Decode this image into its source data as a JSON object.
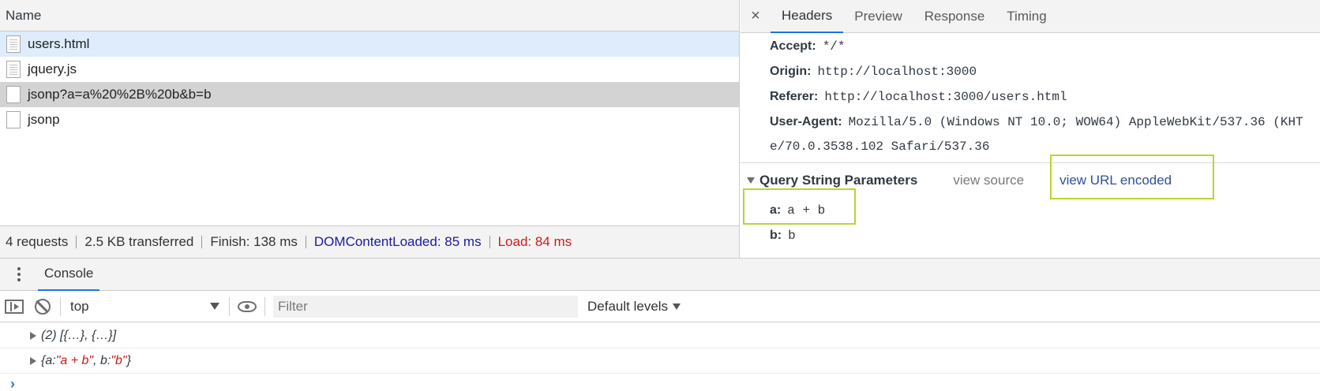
{
  "network": {
    "column_name": "Name",
    "requests": [
      {
        "name": "users.html",
        "icon": "document-icon"
      },
      {
        "name": "jquery.js",
        "icon": "document-icon"
      },
      {
        "name": "jsonp?a=a%20%2B%20b&b=b",
        "icon": "blank-file-icon"
      },
      {
        "name": "jsonp",
        "icon": "blank-file-icon"
      }
    ],
    "status": {
      "requests": "4 requests",
      "transferred": "2.5 KB transferred",
      "finish": "Finish: 138 ms",
      "dom_content_loaded": "DOMContentLoaded: 85 ms",
      "load": "Load: 84 ms"
    }
  },
  "details": {
    "close_symbol": "×",
    "tabs": [
      "Headers",
      "Preview",
      "Response",
      "Timing"
    ],
    "active_tab": "Headers",
    "headers": [
      {
        "key": "Accept:",
        "value": "*/*"
      },
      {
        "key": "Origin:",
        "value": "http://localhost:3000"
      },
      {
        "key": "Referer:",
        "value": "http://localhost:3000/users.html"
      },
      {
        "key": "User-Agent:",
        "value": "Mozilla/5.0 (Windows NT 10.0; WOW64) AppleWebKit/537.36 (KHT"
      }
    ],
    "user_agent_continuation": "e/70.0.3538.102 Safari/537.36",
    "query_string": {
      "title": "Query String Parameters",
      "view_source": "view source",
      "view_url_encoded": "view URL encoded",
      "params": [
        {
          "key": "a:",
          "value": "a + b"
        },
        {
          "key": "b:",
          "value": "b"
        }
      ]
    }
  },
  "drawer": {
    "tab": "Console",
    "toolbar": {
      "context": "top",
      "filter_placeholder": "Filter",
      "levels": "Default levels"
    },
    "output": {
      "line1": "(2) [{…}, {…}]",
      "line2_prefix": "{a: ",
      "line2_a": "\"a + b\"",
      "line2_mid": ", b: ",
      "line2_b": "\"b\"",
      "line2_suffix": "}"
    },
    "prompt_symbol": "›"
  },
  "colors": {
    "highlight_box": "#b9d431",
    "active_tab_underline": "#1a73e8",
    "dom_content_loaded": "#1a1aa6",
    "load": "#d01a1a",
    "string_value": "#c41a16"
  }
}
